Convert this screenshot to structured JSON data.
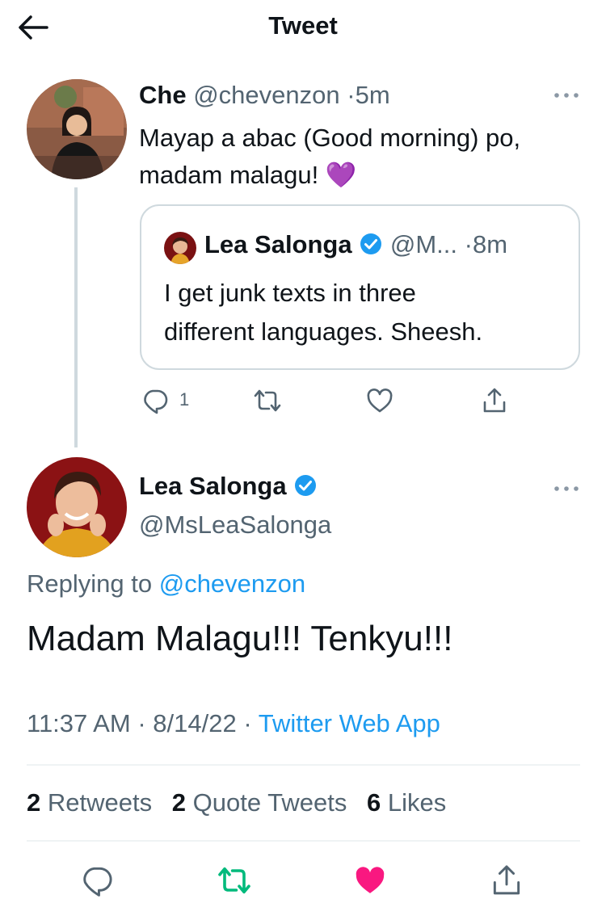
{
  "header": {
    "title": "Tweet"
  },
  "parent_tweet": {
    "name": "Che",
    "handle": "@chevenzon",
    "time": "5m",
    "text_line1": "Mayap a abac (Good morning) po,",
    "text_line2": "madam malagu!",
    "emoji": "💜",
    "quote": {
      "name": "Lea Salonga",
      "handle": "@M...",
      "time": "8m",
      "text_line1": "I get junk texts in three",
      "text_line2": "different languages. Sheesh."
    },
    "reply_count": "1"
  },
  "main_tweet": {
    "name": "Lea Salonga",
    "handle": "@MsLeaSalonga",
    "replying_prefix": "Replying to",
    "replying_to": "@chevenzon",
    "text": "Madam Malagu!!! Tenkyu!!!",
    "time": "11:37 AM",
    "date": "8/14/22",
    "source": "Twitter Web App",
    "stats": {
      "retweets_count": "2",
      "retweets_label": "Retweets",
      "quotes_count": "2",
      "quotes_label": "Quote Tweets",
      "likes_count": "6",
      "likes_label": "Likes"
    }
  },
  "colors": {
    "accent": "#1d9bf0",
    "retweet_green": "#00ba7c",
    "like_pink": "#f91880",
    "muted_text": "#536471"
  },
  "icons": [
    "back-arrow-icon",
    "more-icon",
    "verified-icon",
    "reply-icon",
    "retweet-icon",
    "like-icon",
    "share-icon"
  ]
}
